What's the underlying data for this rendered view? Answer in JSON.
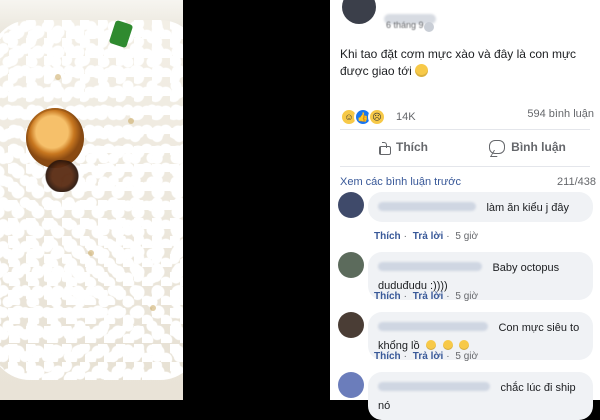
{
  "post": {
    "meta": "6 tháng 9",
    "text": "Khi tao đặt cơm mực xào và đây là con mực được giao tới",
    "reaction_count": "14K",
    "comment_total": "594 bình luận"
  },
  "actions": {
    "like": "Thích",
    "comment": "Bình luận"
  },
  "comments_header": {
    "view_previous": "Xem các bình luận trước",
    "count": "211/438"
  },
  "comments": [
    {
      "text": "làm ăn kiểu j đây",
      "like": "Thích",
      "reply": "Trả lời",
      "time": "5 giờ"
    },
    {
      "text": "Baby octopus duduđudu :))))",
      "like": "Thích",
      "reply": "Trả lời",
      "time": "5 giờ"
    },
    {
      "text": "Con mực siêu to khổng lồ",
      "like": "Thích",
      "reply": "Trả lời",
      "time": "5 giờ"
    },
    {
      "text": "chắc lúc đi ship nó",
      "like": "",
      "reply": "",
      "time": ""
    }
  ],
  "icons": {
    "reaction_haha": "haha-reaction-icon",
    "reaction_like": "like-reaction-icon",
    "reaction_sad": "sad-reaction-icon",
    "like": "thumb-up-icon",
    "comment": "comment-bubble-icon"
  }
}
